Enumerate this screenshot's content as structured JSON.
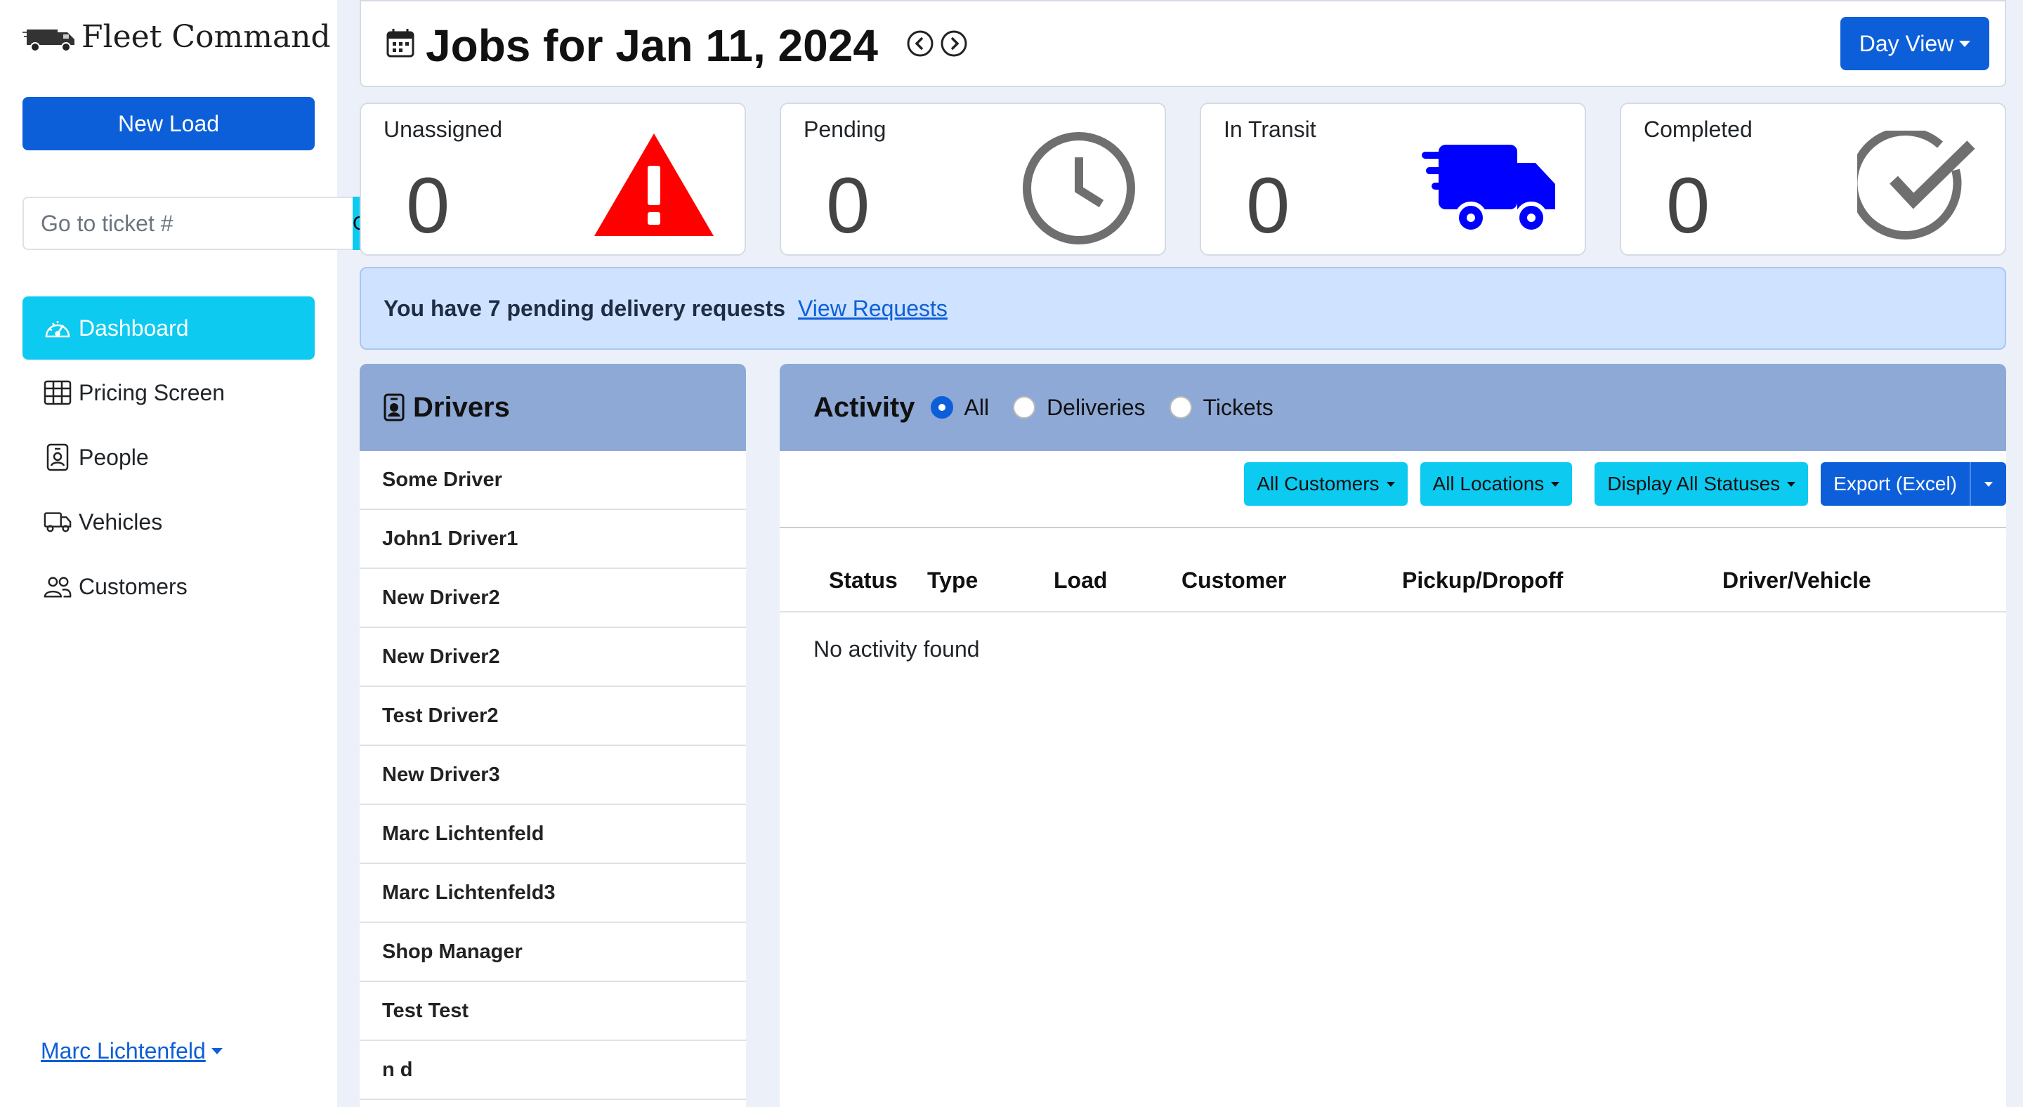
{
  "sidebar": {
    "brand": "Fleet Command",
    "new_load_label": "New Load",
    "ticket_placeholder": "Go to ticket #",
    "go_label": "Go",
    "nav": [
      {
        "label": "Dashboard",
        "icon": "speedometer-icon",
        "active": true
      },
      {
        "label": "Pricing Screen",
        "icon": "table-icon",
        "active": false
      },
      {
        "label": "People",
        "icon": "person-badge-icon",
        "active": false
      },
      {
        "label": "Vehicles",
        "icon": "truck-icon",
        "active": false
      },
      {
        "label": "Customers",
        "icon": "people-icon",
        "active": false
      }
    ],
    "user_name": "Marc Lichtenfeld"
  },
  "header": {
    "title": "Jobs for Jan 11, 2024",
    "view_label": "Day View"
  },
  "stats": [
    {
      "label": "Unassigned",
      "value": "0",
      "icon": "warning-triangle-icon",
      "color": "#ff0000"
    },
    {
      "label": "Pending",
      "value": "0",
      "icon": "clock-icon",
      "color": "#6f6f6f"
    },
    {
      "label": "In Transit",
      "value": "0",
      "icon": "fast-truck-icon",
      "color": "#0000ff"
    },
    {
      "label": "Completed",
      "value": "0",
      "icon": "check-circle-icon",
      "color": "#6f6f6f"
    }
  ],
  "alert": {
    "text": "You have 7 pending delivery requests",
    "link": "View Requests"
  },
  "drivers": {
    "title": "Drivers",
    "items": [
      "Some Driver",
      "John1 Driver1",
      "New Driver2",
      "New Driver2",
      "Test Driver2",
      "New Driver3",
      "Marc Lichtenfeld",
      "Marc Lichtenfeld3",
      "Shop Manager",
      "Test Test",
      "n d"
    ]
  },
  "activity": {
    "title": "Activity",
    "filters": [
      {
        "label": "All",
        "checked": true
      },
      {
        "label": "Deliveries",
        "checked": false
      },
      {
        "label": "Tickets",
        "checked": false
      }
    ],
    "toolbar": {
      "customers": "All Customers",
      "locations": "All Locations",
      "statuses": "Display All Statuses",
      "export": "Export (Excel)"
    },
    "columns": [
      "Status",
      "Type",
      "Load",
      "Customer",
      "Pickup/Dropoff",
      "Driver/Vehicle"
    ],
    "empty_text": "No activity found"
  },
  "colors": {
    "primary": "#0d5fd9",
    "info": "#0dcaf0",
    "panel_header": "#8ea9d6",
    "alert_bg": "#cfe2ff"
  }
}
